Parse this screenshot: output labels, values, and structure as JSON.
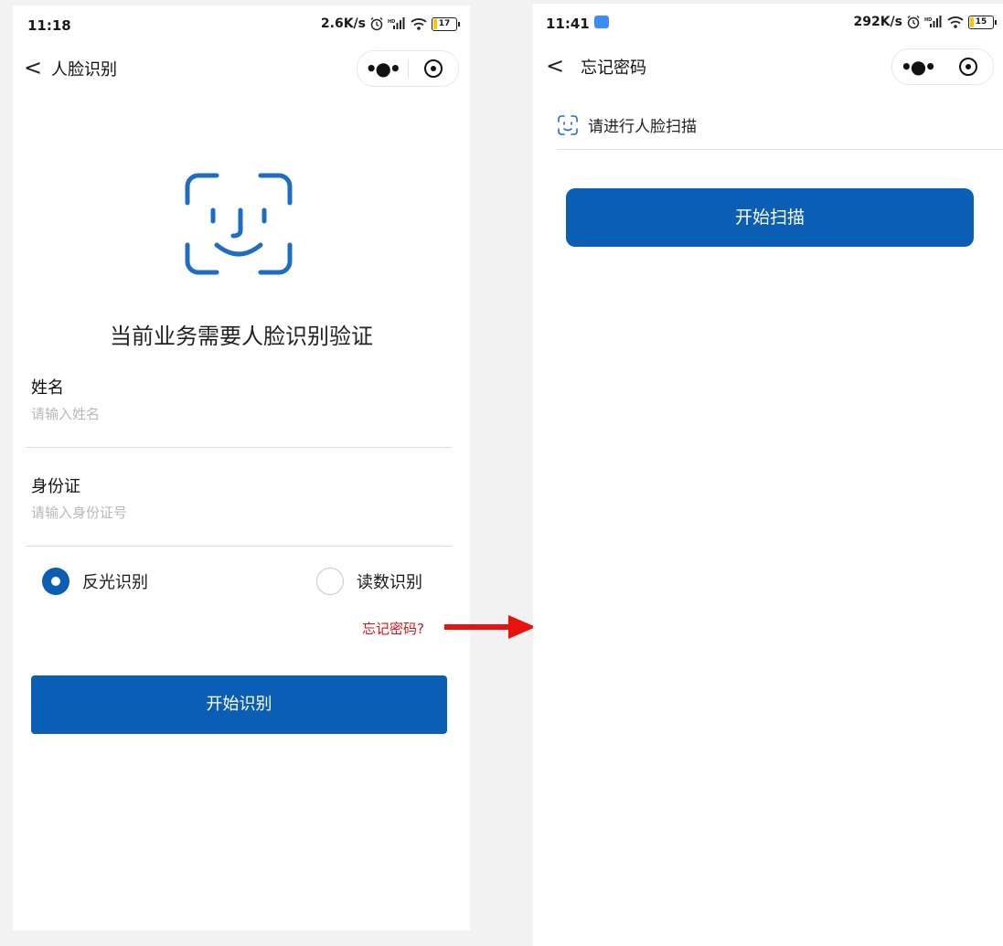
{
  "left_screen": {
    "status_bar": {
      "time": "11:18",
      "net_speed": "2.6K/s",
      "battery": "17"
    },
    "nav": {
      "back": "<",
      "title": "人脸识别"
    },
    "headline": "当前业务需要人脸识别验证",
    "name_field": {
      "label": "姓名",
      "placeholder": "请输入姓名"
    },
    "id_field": {
      "label": "身份证",
      "placeholder": "请输入身份证号"
    },
    "radio_options": [
      {
        "label": "反光识别",
        "selected": true
      },
      {
        "label": "读数识别",
        "selected": false
      }
    ],
    "forgot_password": "忘记密码?",
    "start_button": "开始识别"
  },
  "right_screen": {
    "status_bar": {
      "time": "11:41",
      "net_speed": "292K/s",
      "battery": "15"
    },
    "nav": {
      "back": "<",
      "title": "忘记密码"
    },
    "scan_prompt": "请进行人脸扫描",
    "start_button": "开始扫描"
  },
  "colors": {
    "accent": "#0a5fb4",
    "link": "#d01616",
    "arrow": "#e8120f"
  },
  "icons": [
    "back-chevron-icon",
    "more-dots-icon",
    "target-circle-icon",
    "face-scan-icon",
    "wifi-icon",
    "signal-icon",
    "alarm-icon",
    "battery-icon",
    "radio-selected-icon",
    "radio-unselected-icon",
    "arrow-right-icon"
  ]
}
